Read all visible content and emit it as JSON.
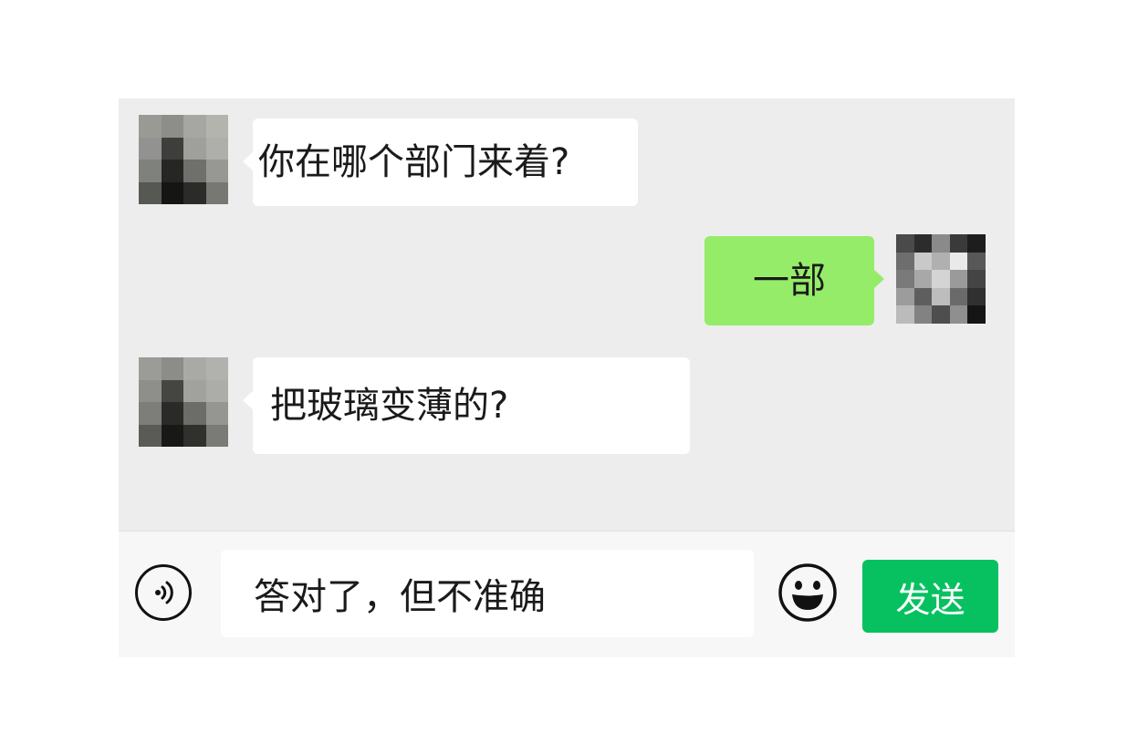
{
  "messages": [
    {
      "side": "left",
      "text": "你在哪个部门来着?"
    },
    {
      "side": "right",
      "text": "一部"
    },
    {
      "side": "left",
      "text": "把玻璃变薄的?"
    }
  ],
  "input_bar": {
    "draft_text": "答对了，但不准确",
    "send_label": "发送"
  },
  "colors": {
    "chat_background": "#ededed",
    "incoming_bubble": "#ffffff",
    "outgoing_bubble": "#95ec69",
    "send_button": "#07c160",
    "input_bar": "#f7f7f7"
  },
  "icons": {
    "voice": "voice-icon",
    "emoji": "smiley-face-icon"
  }
}
